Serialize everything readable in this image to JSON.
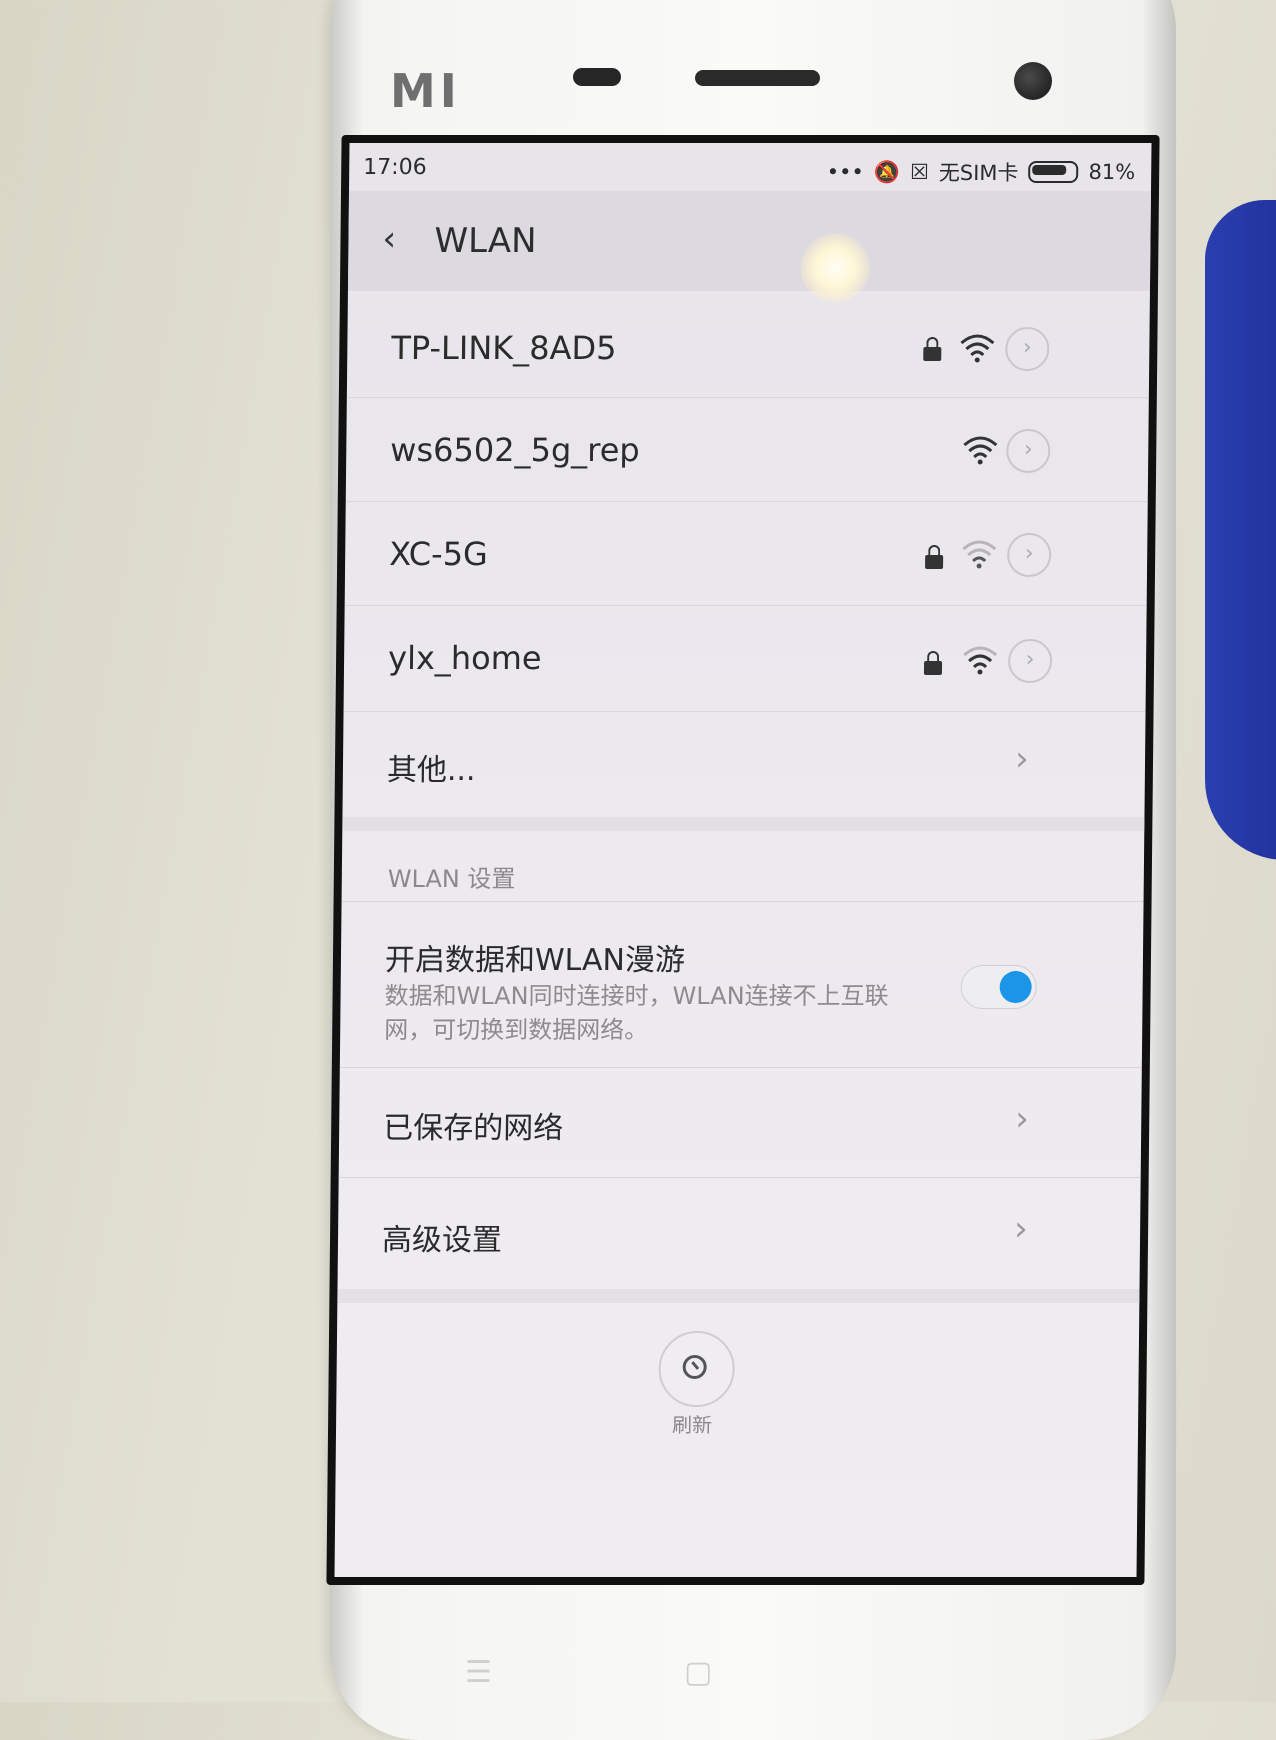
{
  "status_bar": {
    "time": "17:06",
    "sim": "无SIM卡",
    "battery": "81%"
  },
  "header": {
    "title": "WLAN"
  },
  "networks": [
    {
      "name": "TP-LINK_8AD5",
      "locked": true
    },
    {
      "name": "ws6502_5g_rep",
      "locked": false
    },
    {
      "name": "XC-5G",
      "locked": true
    },
    {
      "name": "ylx_home",
      "locked": true
    }
  ],
  "other_label": "其他...",
  "settings": {
    "section_label": "WLAN 设置",
    "roaming_title": "开启数据和WLAN漫游",
    "roaming_desc": "数据和WLAN同时连接时，WLAN连接不上互联网，可切换到数据网络。",
    "roaming_enabled": true,
    "saved_networks": "已保存的网络",
    "advanced": "高级设置"
  },
  "refresh_label": "刷新",
  "device_logo": "MI",
  "colors": {
    "toggle_accent": "#1a95e8"
  }
}
